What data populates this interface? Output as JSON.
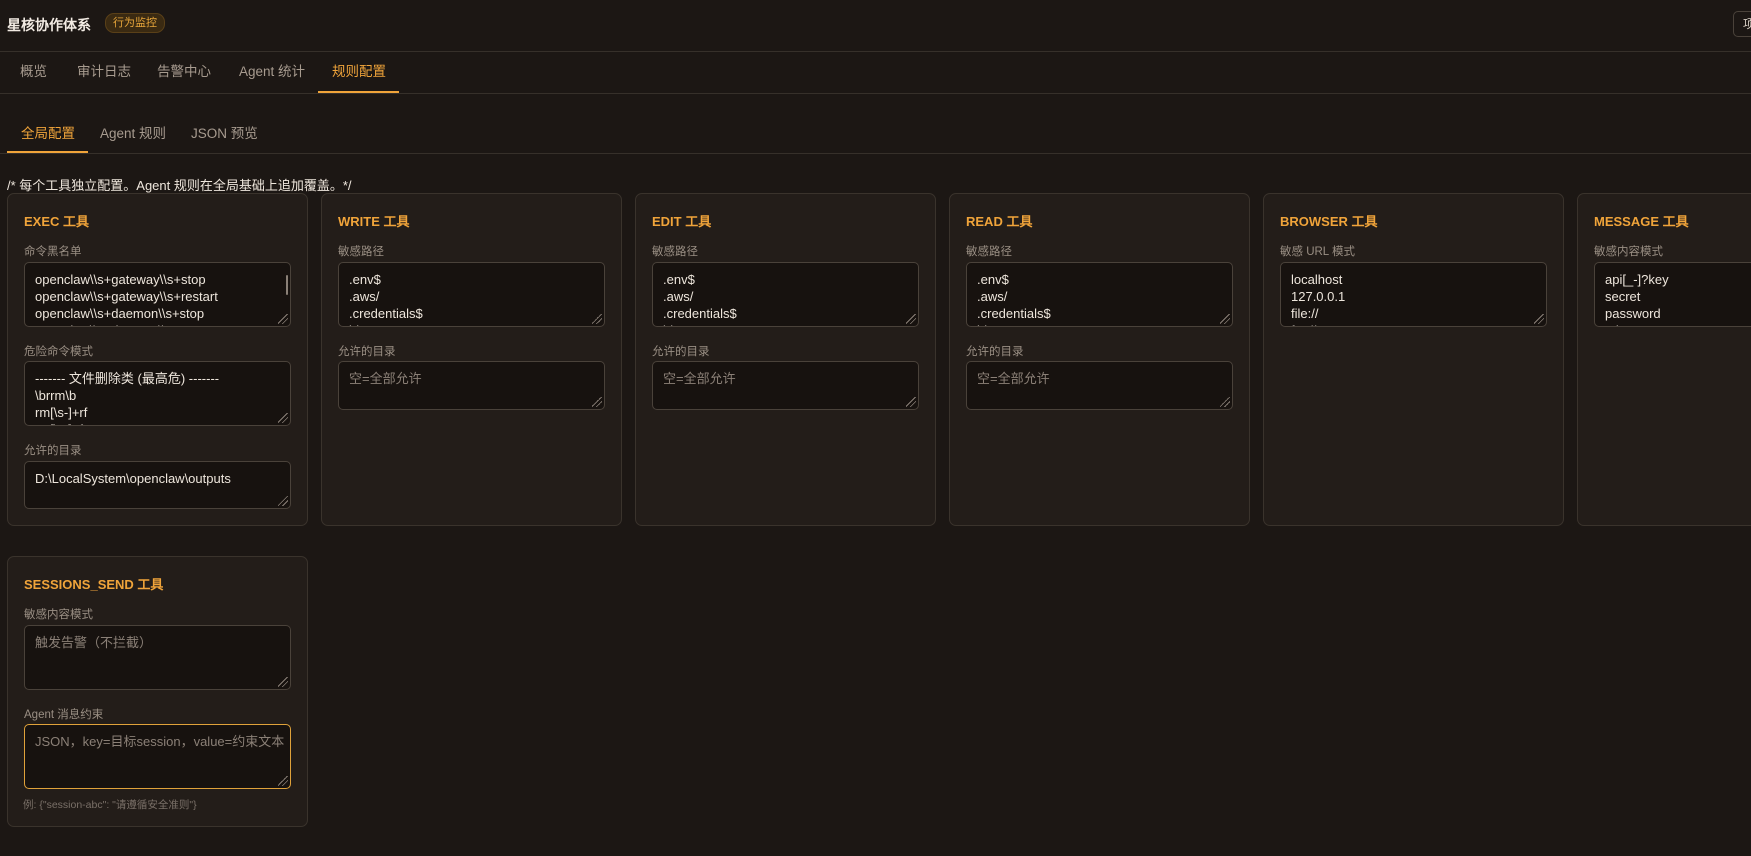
{
  "app": {
    "title": "星核协作体系",
    "badge": "行为监控",
    "top_right_button": "项目"
  },
  "main_tabs": [
    {
      "label": "概览",
      "active": false
    },
    {
      "label": "审计日志",
      "active": false
    },
    {
      "label": "告警中心",
      "active": false
    },
    {
      "label": "Agent 统计",
      "active": false
    },
    {
      "label": "规则配置",
      "active": true
    }
  ],
  "sub_tabs": [
    {
      "label": "全局配置",
      "active": true
    },
    {
      "label": "Agent 规则",
      "active": false
    },
    {
      "label": "JSON 预览",
      "active": false
    }
  ],
  "comment": "/* 每个工具独立配置。Agent 规则在全局基础上追加覆盖。*/",
  "cards": {
    "exec": {
      "title": "EXEC 工具",
      "f1_label": "命令黑名单",
      "f1_value": "openclaw\\\\s+gateway\\\\s+stop\nopenclaw\\\\s+gateway\\\\s+restart\nopenclaw\\\\s+daemon\\\\s+stop\nopenclaw\\\\s+daemon\\\\s+restart",
      "f2_label": "危险命令模式",
      "f2_value": "------- 文件删除类 (最高危) -------\n\\brrm\\b\nrm[\\s-]+rf\nrm[\\s-]+fr",
      "f3_label": "允许的目录",
      "f3_value": "D:\\LocalSystem\\openclaw\\outputs"
    },
    "write": {
      "title": "WRITE 工具",
      "f1_label": "敏感路径",
      "f1_value": ".env$\n.aws/\n.credentials$\nid_rsa",
      "f2_label": "允许的目录",
      "f2_placeholder": "空=全部允许"
    },
    "edit": {
      "title": "EDIT 工具",
      "f1_label": "敏感路径",
      "f1_value": ".env$\n.aws/\n.credentials$\nid_rsa",
      "f2_label": "允许的目录",
      "f2_placeholder": "空=全部允许"
    },
    "read": {
      "title": "READ 工具",
      "f1_label": "敏感路径",
      "f1_value": ".env$\n.aws/\n.credentials$\nid_rsa",
      "f2_label": "允许的目录",
      "f2_placeholder": "空=全部允许"
    },
    "browser": {
      "title": "BROWSER 工具",
      "f1_label": "敏感 URL 模式",
      "f1_value": "localhost\n127.0.0.1\nfile://\nftp://"
    },
    "message": {
      "title": "MESSAGE 工具",
      "f1_label": "敏感内容模式",
      "f1_value": "api[_-]?key\nsecret\npassword\ntoken"
    },
    "sessions_send": {
      "title": "SESSIONS_SEND 工具",
      "f1_label": "敏感内容模式",
      "f1_placeholder": "触发告警（不拦截）",
      "f2_label": "Agent 消息约束",
      "f2_placeholder": "JSON，key=目标session，value=约束文本",
      "hint": "例: {\"session-abc\": \"请遵循安全准则\"}"
    }
  }
}
